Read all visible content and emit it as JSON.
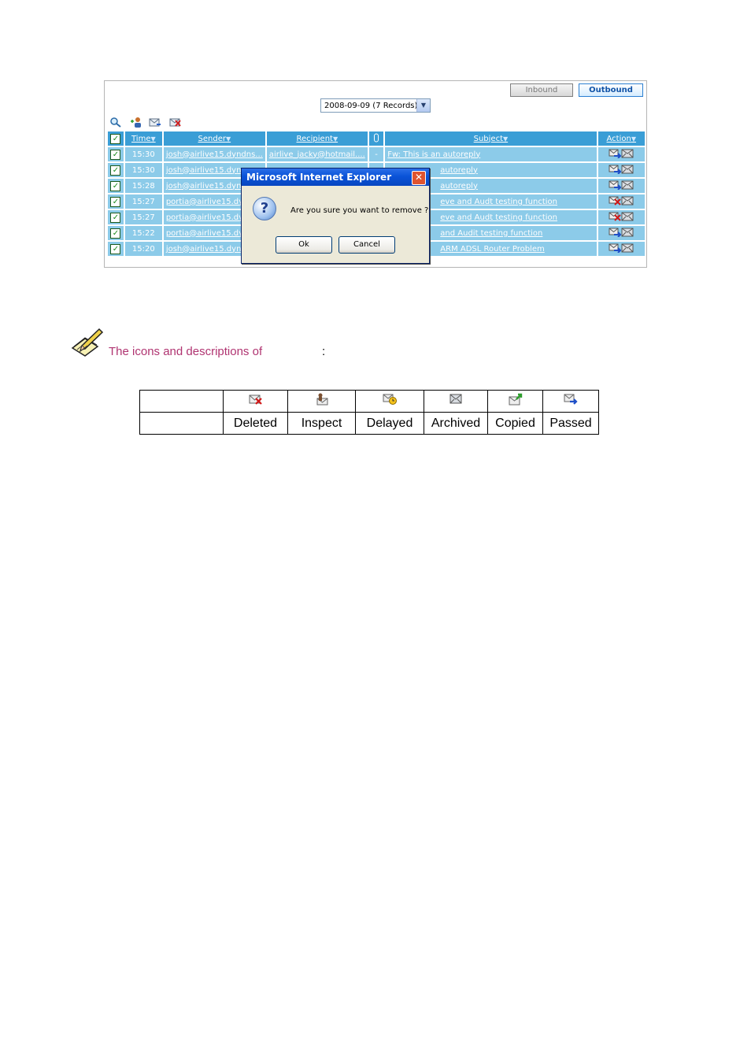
{
  "panel": {
    "inbound_label": "Inbound",
    "outbound_label": "Outbound",
    "date_select": "2008-09-09 (7 Records)",
    "toolbar_icons": [
      "search-icon",
      "user-add-icon",
      "mail-forward-icon",
      "mail-delete-icon"
    ],
    "columns": {
      "time": "Time",
      "sender": "Sender",
      "recipient": "Recipient",
      "subject": "Subject",
      "action": "Action"
    },
    "rows": [
      {
        "time": "15:30",
        "sender": "josh@airlive15.dyndns...",
        "recipient": "airlive_jacky@hotmail....",
        "attach": "-",
        "subject": "Fw: This is an autoreply",
        "action_icon": "passed-icon"
      },
      {
        "time": "15:30",
        "sender": "josh@airlive15.dyn",
        "recipient": "",
        "attach": "",
        "subject": "autoreply",
        "action_icon": "passed-icon"
      },
      {
        "time": "15:28",
        "sender": "josh@airlive15.dyn",
        "recipient": "",
        "attach": "",
        "subject": "autoreply",
        "action_icon": "passed-icon"
      },
      {
        "time": "15:27",
        "sender": "portia@airlive15.dy",
        "recipient": "",
        "attach": "",
        "subject": "eve and Audt testing function",
        "action_icon": "deleted-icon"
      },
      {
        "time": "15:27",
        "sender": "portia@airlive15.dy",
        "recipient": "",
        "attach": "",
        "subject": "eve and Audt testing function",
        "action_icon": "deleted-icon"
      },
      {
        "time": "15:22",
        "sender": "portia@airlive15.dy",
        "recipient": "",
        "attach": "",
        "subject": "and Audit testing function",
        "action_icon": "passed-icon"
      },
      {
        "time": "15:20",
        "sender": "josh@airlive15.dyn",
        "recipient": "",
        "attach": "",
        "subject": "ARM ADSL Router Problem",
        "action_icon": "passed-icon"
      }
    ]
  },
  "dialog": {
    "title": "Microsoft Internet Explorer",
    "message": "Are you sure you want to remove ?",
    "ok_label": "Ok",
    "cancel_label": "Cancel"
  },
  "note": {
    "text": "The icons and descriptions of",
    "colon": ":"
  },
  "legend": {
    "labels": [
      "Deleted",
      "Inspect",
      "Delayed",
      "Archived",
      "Copied",
      "Passed"
    ],
    "icons": [
      "deleted-icon",
      "inspect-icon",
      "delayed-icon",
      "archived-icon",
      "copied-icon",
      "passed-icon"
    ]
  }
}
